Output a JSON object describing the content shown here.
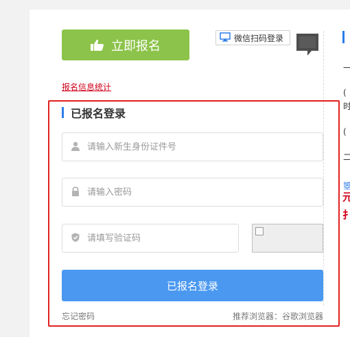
{
  "header": {
    "register_label": "立即报名",
    "wechat_login_label": "微信扫码登录"
  },
  "links": {
    "stats_label": "报名信息统计",
    "forgot_password_label": "忘记密码"
  },
  "login": {
    "title": "已报名登录",
    "id_placeholder": "请输入新生身份证件号",
    "password_placeholder": "请输入密码",
    "captcha_placeholder": "请填写验证码",
    "submit_label": "已报名登录",
    "browser_tip": "推荐浏览器：谷歌浏览器"
  },
  "icons": [
    "thumbs-up-icon",
    "monitor-icon",
    "qr-toggle-icon",
    "user-icon",
    "lock-icon",
    "shield-icon",
    "broken-image-icon"
  ],
  "colors": {
    "register_green": "#8cc34a",
    "submit_blue": "#4a98f0",
    "highlight_red": "#e0201f",
    "link_red": "#d0021b",
    "accent_blue": "#2b7de9"
  }
}
